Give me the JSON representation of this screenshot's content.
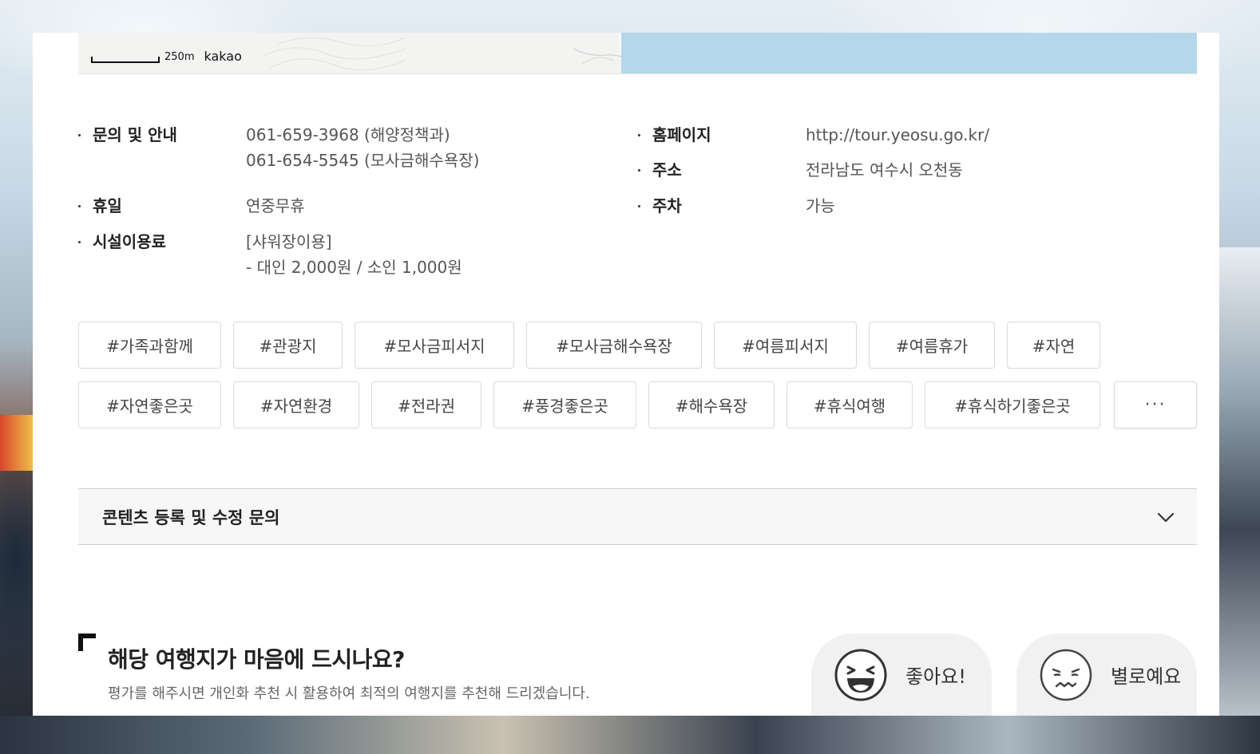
{
  "map": {
    "scale_text": "250m",
    "provider": "kakao",
    "colors": {
      "water": "#b5d7ea",
      "land": "#f3f4f2"
    }
  },
  "info": {
    "contact": {
      "label": "문의 및 안내",
      "values": [
        "061-659-3968 (해양정책과)",
        "061-654-5545 (모사금해수욕장)"
      ]
    },
    "closed": {
      "label": "휴일",
      "value": "연중무휴"
    },
    "fee": {
      "label": "시설이용료",
      "values": [
        "[샤워장이용]",
        "- 대인 2,000원 / 소인 1,000원"
      ]
    },
    "homepage": {
      "label": "홈페이지",
      "value": "http://tour.yeosu.go.kr/"
    },
    "address": {
      "label": "주소",
      "value": "전라남도 여수시 오천동"
    },
    "parking": {
      "label": "주차",
      "value": "가능"
    }
  },
  "tags": {
    "row1": [
      "#가족과함께",
      "#관광지",
      "#모사금피서지",
      "#모사금해수욕장",
      "#여름피서지",
      "#여름휴가",
      "#자연"
    ],
    "row2": [
      "#자연좋은곳",
      "#자연환경",
      "#전라권",
      "#풍경좋은곳",
      "#해수욕장",
      "#휴식여행",
      "#휴식하기좋은곳"
    ],
    "more_label": "···"
  },
  "accordion": {
    "title": "콘텐츠 등록 및 수정 문의",
    "icon": "chevron-down-icon"
  },
  "feedback": {
    "question": "해당 여행지가 마음에 드시나요?",
    "description": "평가를 해주시면 개인화 추천 시 활용하여 최적의 여행지를 추천해 드리겠습니다.",
    "like_label": "좋아요!",
    "dislike_label": "별로예요",
    "icons": {
      "like": "laughing-face-icon",
      "dislike": "sad-face-icon"
    }
  }
}
